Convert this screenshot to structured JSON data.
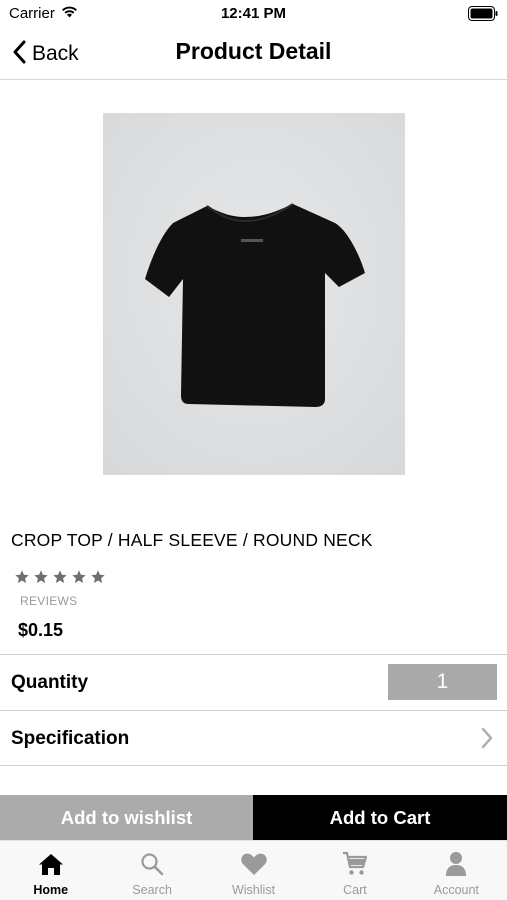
{
  "status_bar": {
    "carrier": "Carrier",
    "time": "12:41 PM"
  },
  "nav": {
    "back_label": "Back",
    "title": "Product Detail"
  },
  "product": {
    "name": "CROP TOP / HALF SLEEVE / ROUND NECK",
    "rating": 0,
    "max_rating": 5,
    "reviews_label": "REVIEWS",
    "price": "$0.15",
    "image_icon": "black-tshirt-image"
  },
  "quantity": {
    "label": "Quantity",
    "value": "1"
  },
  "specification": {
    "label": "Specification"
  },
  "actions": {
    "wishlist_label": "Add to wishlist",
    "cart_label": "Add to Cart"
  },
  "tabs": [
    {
      "label": "Home",
      "icon": "home-icon",
      "active": true
    },
    {
      "label": "Search",
      "icon": "search-icon",
      "active": false
    },
    {
      "label": "Wishlist",
      "icon": "heart-icon",
      "active": false
    },
    {
      "label": "Cart",
      "icon": "cart-icon",
      "active": false
    },
    {
      "label": "Account",
      "icon": "person-icon",
      "active": false
    }
  ],
  "colors": {
    "accent_dark": "#000000",
    "muted_button": "#ababab",
    "star": "#6e6e6e",
    "inactive_tab": "#9a9a9a"
  }
}
